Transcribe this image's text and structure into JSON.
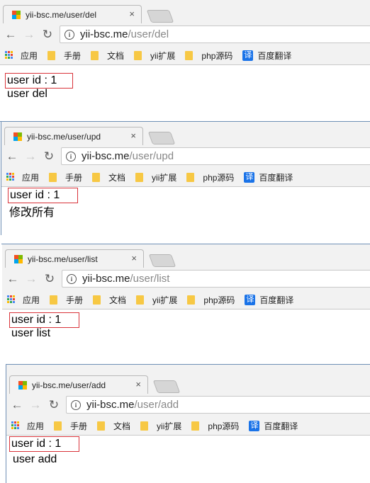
{
  "windows": [
    {
      "id": "del",
      "tab_title": "yii-bsc.me/user/del",
      "close": "×",
      "url_host": "yii-bsc.me",
      "url_path": "/user/del",
      "user_id": "user id : 1",
      "content": "user del"
    },
    {
      "id": "upd",
      "tab_title": "yii-bsc.me/user/upd",
      "close": "×",
      "url_host": "yii-bsc.me",
      "url_path": "/user/upd",
      "user_id": "user id : 1",
      "content": "修改所有"
    },
    {
      "id": "list",
      "tab_title": "yii-bsc.me/user/list",
      "close": "×",
      "url_host": "yii-bsc.me",
      "url_path": "/user/list",
      "user_id": "user id : 1",
      "content": "user list"
    },
    {
      "id": "add",
      "tab_title": "yii-bsc.me/user/add",
      "close": "×",
      "url_host": "yii-bsc.me",
      "url_path": "/user/add",
      "user_id": "user id : 1",
      "content": "user add"
    }
  ],
  "nav": {
    "back": "←",
    "forward": "→",
    "reload": "↻",
    "info": "i"
  },
  "bookmarks": {
    "apps": "应用",
    "manual": "手册",
    "docs": "文档",
    "yii_ext": "yii扩展",
    "php_source": "php源码",
    "translate": "百度翻译",
    "translate_icon": "译"
  },
  "colors": {
    "highlight_box": "#d9333a",
    "bookmark_folder": "#f7c844",
    "translate_icon_bg": "#1a73e8"
  }
}
